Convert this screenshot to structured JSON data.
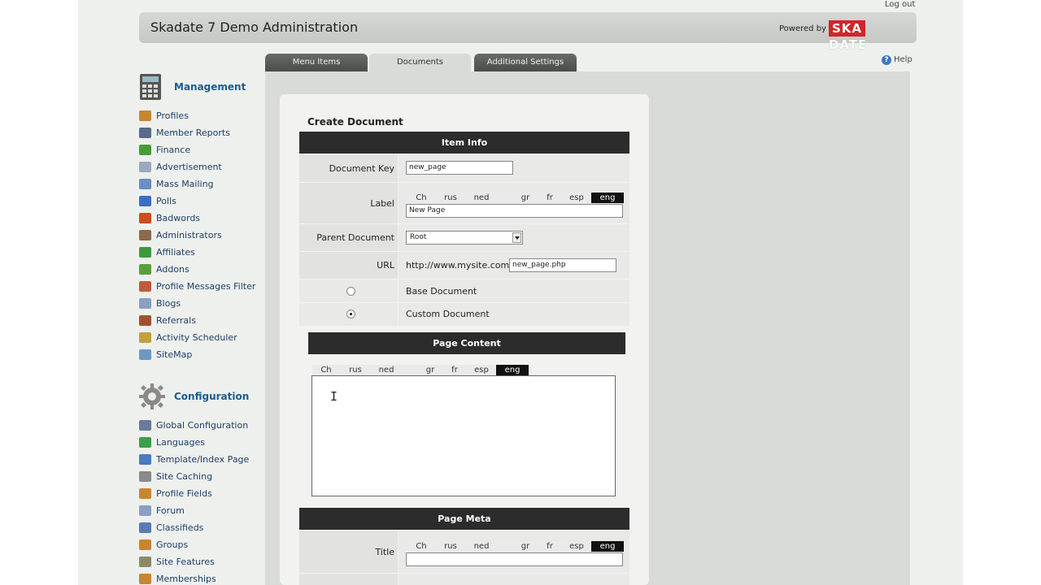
{
  "header": {
    "logout": "Log out",
    "title": "Skadate 7 Demo Administration",
    "powered_by": "Powered by",
    "brand_left": "SKA",
    "brand_right": "DATE"
  },
  "tabs": [
    {
      "label": "Menu Items",
      "active": false
    },
    {
      "label": "Documents",
      "active": true
    },
    {
      "label": "Additional Settings",
      "active": false
    }
  ],
  "help": "Help",
  "sidebar": {
    "management_title": "Management",
    "management_items": [
      {
        "label": "Profiles",
        "icon": "profiles-icon",
        "color": "#c9852d"
      },
      {
        "label": "Member Reports",
        "icon": "member-reports-icon",
        "color": "#5a6b8a"
      },
      {
        "label": "Finance",
        "icon": "finance-icon",
        "color": "#4a9a3a"
      },
      {
        "label": "Advertisement",
        "icon": "advertisement-icon",
        "color": "#9aa9c2"
      },
      {
        "label": "Mass Mailing",
        "icon": "mass-mailing-icon",
        "color": "#6b8fc2"
      },
      {
        "label": "Polls",
        "icon": "polls-icon",
        "color": "#3b6fc2"
      },
      {
        "label": "Badwords",
        "icon": "badwords-icon",
        "color": "#d24a1e"
      },
      {
        "label": "Administrators",
        "icon": "administrators-icon",
        "color": "#8a6a4a"
      },
      {
        "label": "Affiliates",
        "icon": "affiliates-icon",
        "color": "#3a9a3a"
      },
      {
        "label": "Addons",
        "icon": "addons-icon",
        "color": "#5aa03a"
      },
      {
        "label": "Profile Messages Filter",
        "icon": "messages-filter-icon",
        "color": "#c25a3a"
      },
      {
        "label": "Blogs",
        "icon": "blogs-icon",
        "color": "#8aa0c2"
      },
      {
        "label": "Referrals",
        "icon": "referrals-icon",
        "color": "#a0522d"
      },
      {
        "label": "Activity Scheduler",
        "icon": "activity-scheduler-icon",
        "color": "#c2a03a"
      },
      {
        "label": "SiteMap",
        "icon": "sitemap-icon",
        "color": "#6a9ac2"
      }
    ],
    "configuration_title": "Configuration",
    "configuration_items": [
      {
        "label": "Global Configuration",
        "icon": "global-configuration-icon",
        "color": "#6a7a9a"
      },
      {
        "label": "Languages",
        "icon": "languages-icon",
        "color": "#3aa04a"
      },
      {
        "label": "Template/Index Page",
        "icon": "template-icon",
        "color": "#4a7ac2"
      },
      {
        "label": "Site Caching",
        "icon": "site-caching-icon",
        "color": "#8a8a8a"
      },
      {
        "label": "Profile Fields",
        "icon": "profile-fields-icon",
        "color": "#c9852d"
      },
      {
        "label": "Forum",
        "icon": "forum-icon",
        "color": "#8aa0c2"
      },
      {
        "label": "Classifieds",
        "icon": "classifieds-icon",
        "color": "#5a7ab2"
      },
      {
        "label": "Groups",
        "icon": "groups-icon",
        "color": "#c9852d"
      },
      {
        "label": "Site Features",
        "icon": "site-features-icon",
        "color": "#8a8a6a"
      },
      {
        "label": "Memberships",
        "icon": "memberships-icon",
        "color": "#c9852d"
      }
    ]
  },
  "form": {
    "heading": "Create Document",
    "item_info_bar": "Item Info",
    "document_key_label": "Document Key",
    "document_key_value": "new_page",
    "label_label": "Label",
    "languages": [
      "Ch",
      "rus",
      "ned",
      "",
      "gr",
      "fr",
      "esp",
      "eng"
    ],
    "active_language": "eng",
    "label_value": "New Page",
    "parent_document_label": "Parent Document",
    "parent_document_value": "Root",
    "url_label": "URL",
    "url_prefix": "http://www.mysite.com/",
    "url_value": "new_page.php",
    "base_document_label": "Base Document",
    "custom_document_label": "Custom Document",
    "selected_document_type": "Custom Document",
    "page_content_bar": "Page Content",
    "page_content_value": "",
    "page_meta_bar": "Page Meta",
    "title_label": "Title",
    "title_value": ""
  }
}
